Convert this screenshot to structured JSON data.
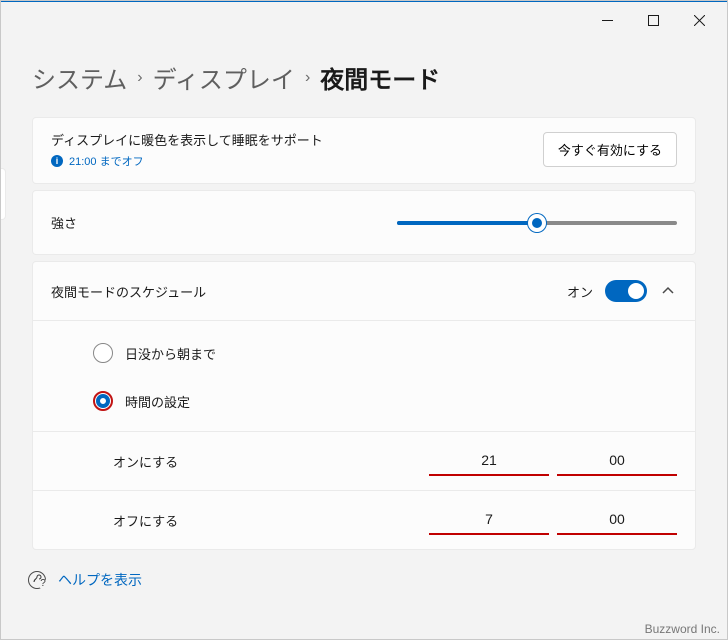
{
  "breadcrumb": {
    "level1": "システム",
    "level2": "ディスプレイ",
    "current": "夜間モード"
  },
  "description": {
    "title": "ディスプレイに暖色を表示して睡眠をサポート",
    "subtitle": "21:00 までオフ"
  },
  "turn_on_label": "今すぐ有効にする",
  "strength": {
    "label": "強さ",
    "percent": 50
  },
  "schedule": {
    "label": "夜間モードのスケジュール",
    "state_text": "オン",
    "on": true,
    "options": {
      "sunset": "日没から朝まで",
      "set_hours": "時間の設定"
    },
    "selected": "set_hours",
    "turn_on_label": "オンにする",
    "turn_off_label": "オフにする",
    "on_time": {
      "hour": "21",
      "minute": "00"
    },
    "off_time": {
      "hour": "7",
      "minute": "00"
    }
  },
  "help_label": "ヘルプを表示",
  "watermark": "Buzzword Inc."
}
